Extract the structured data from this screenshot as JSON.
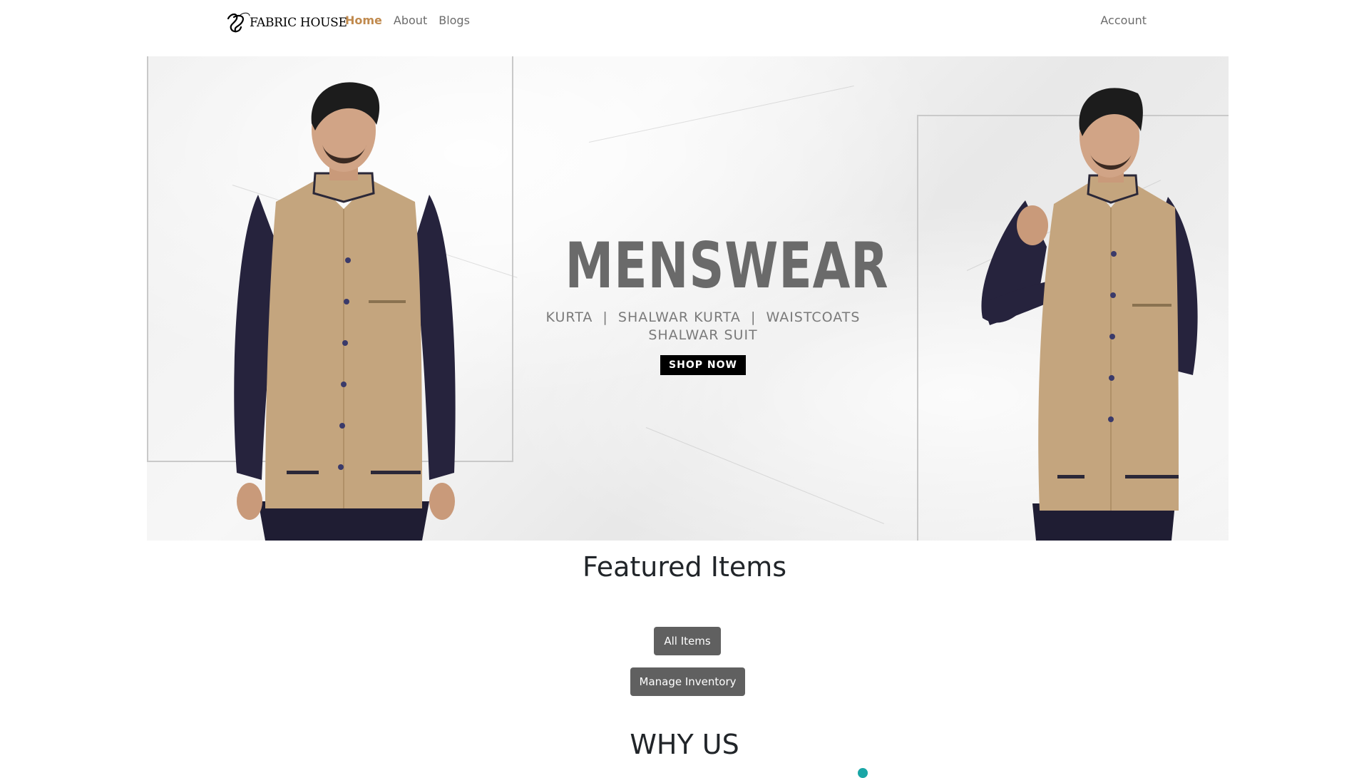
{
  "navbar": {
    "brand": "FABRIC HOUSE",
    "links": [
      {
        "label": "Home",
        "active": true
      },
      {
        "label": "About",
        "active": false
      },
      {
        "label": "Blogs",
        "active": false
      }
    ],
    "account": "Account"
  },
  "hero": {
    "title": "MENSWEAR",
    "subtitle_line1": "KURTA  |  SHALWAR KURTA  |  WAISTCOATS",
    "subtitle_line2": "SHALWAR SUIT",
    "cta": "SHOP NOW"
  },
  "featured": {
    "title": "Featured Items",
    "all_items": "All Items",
    "manage_inventory": "Manage Inventory"
  },
  "why_us": {
    "title": "WHY US"
  },
  "colors": {
    "active_nav": "#c08a4e",
    "button_bg": "#606060",
    "accent_dot": "#1aa6a6"
  }
}
